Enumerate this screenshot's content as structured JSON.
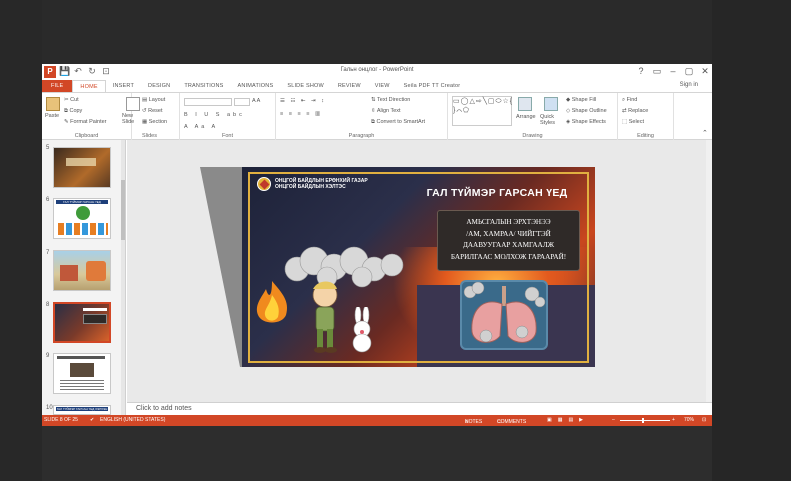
{
  "window": {
    "title": "Гальн онцлог - PowerPoint",
    "signin": "Sign in",
    "quick_access": [
      "save-icon",
      "undo-icon",
      "redo-icon",
      "start-icon"
    ]
  },
  "tabs": [
    "FILE",
    "HOME",
    "INSERT",
    "DESIGN",
    "TRANSITIONS",
    "ANIMATIONS",
    "SLIDE SHOW",
    "REVIEW",
    "VIEW",
    "Seila PDF TT Creator"
  ],
  "active_tab": "HOME",
  "ribbon": {
    "clipboard": {
      "label": "Clipboard",
      "paste": "Paste",
      "cut": "Cut",
      "copy": "Copy",
      "format_painter": "Format Painter"
    },
    "slides": {
      "label": "Slides",
      "new_slide": "New Slide",
      "layout": "Layout",
      "reset": "Reset",
      "section": "Section"
    },
    "font": {
      "label": "Font"
    },
    "paragraph": {
      "label": "Paragraph",
      "text_direction": "Text Direction",
      "align_text": "Align Text",
      "convert": "Convert to SmartArt"
    },
    "drawing": {
      "label": "Drawing",
      "arrange": "Arrange",
      "quick_styles": "Quick Styles",
      "shape_fill": "Shape Fill",
      "shape_outline": "Shape Outline",
      "shape_effects": "Shape Effects"
    },
    "editing": {
      "label": "Editing",
      "find": "Find",
      "replace": "Replace",
      "select": "Select"
    }
  },
  "thumbnails": [
    {
      "num": "5",
      "selected": false
    },
    {
      "num": "6",
      "selected": false,
      "caption": "ГАЛ ТҮЙМЭР ГАРСАН ҮЕД"
    },
    {
      "num": "7",
      "selected": false
    },
    {
      "num": "8",
      "selected": true
    },
    {
      "num": "9",
      "selected": false
    },
    {
      "num": "10",
      "selected": false,
      "caption": "ГАЛ ТҮЙМЭР ГАРСАН ҮЕД ХЭРХЭН"
    }
  ],
  "slide": {
    "org_line1": "ОНЦГОЙ БАЙДЛЫН ЕРӨНХИЙ ГАЗАР",
    "org_line2": "ОНЦГОЙ БАЙДЛЫН ХЭЛТЭС",
    "headline": "ГАЛ ТҮЙМЭР ГАРСАН ҮЕД",
    "box_line1": "АМЬСГАЛЫН ЭРХТЭНЭЭ",
    "box_line2": "/АМ, ХАМРАА/ ЧИЙГТЭЙ",
    "box_line3": "ДААВУУГААР ХАМГААЛЖ",
    "box_line4": "БАРИЛГААС МОЛХОЖ ГАРААРАЙ!"
  },
  "notes_placeholder": "Click to add notes",
  "status": {
    "slide_of": "SLIDE 8 OF 25",
    "language": "ENGLISH (UNITED STATES)",
    "notes": "NOTES",
    "comments": "COMMENTS",
    "zoom": "70%"
  },
  "colors": {
    "accent": "#d24726",
    "slide_border": "#e0b040",
    "box_bg": "#2f2a28"
  }
}
